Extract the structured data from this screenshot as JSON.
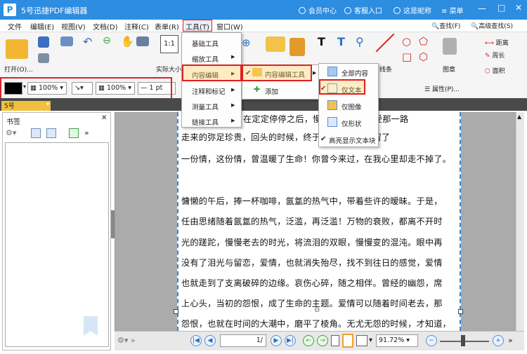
{
  "window": {
    "title": "5号迅捷PDF编辑器",
    "member_center": "会员中心",
    "customer_service": "客服入口",
    "nickname": "这是昵称",
    "menu_label": "菜单"
  },
  "menubar": {
    "items": [
      "文件",
      "编辑(E)",
      "视图(V)",
      "文档(D)",
      "注释(C)",
      "表单(R)",
      "工具(T)",
      "窗口(W)"
    ]
  },
  "ribbon": {
    "open_label": "打开(O)...",
    "actual_size_label": "实际大小",
    "line_label": "线条",
    "stamp_label": "图章",
    "find_label": "查找(F)",
    "advanced_find_label": "高级查找(S)",
    "distance_label": "距离",
    "perimeter_label": "周长",
    "area_label": "面积",
    "add_label": "添加",
    "properties_label": "属性(P)..."
  },
  "format_bar": {
    "opacity_1": "100%",
    "opacity_2": "100%",
    "line_width": "1 pt"
  },
  "tools_menu": {
    "items": [
      "基础工具",
      "缩放工具",
      "内容编辑",
      "注释和标记",
      "测量工具",
      "链接工具"
    ]
  },
  "content_edit_menu": {
    "items": [
      "内容编辑工具",
      "添加"
    ]
  },
  "content_edit_tools_menu": {
    "items": [
      "全部内容",
      "仅文本",
      "仅图像",
      "仅形状",
      "高亮显示文本块"
    ]
  },
  "tab": {
    "label": "5号"
  },
  "sidebar": {
    "title": "书签"
  },
  "document": {
    "lines": [
      "在定定停停之后，慢慢的移步，感受那一路",
      "走来的弥足珍贵，回头的时候，终于的拐角处，逗留了",
      "一份情，这份情，曾温暖了生命！你曾今来过，在我心里却走不掉了。",
      "",
      "慵懒的午后，捧一杯咖啡，氤氲的热气中，带着些许的暧昧。于是，",
      "任由思绪随着氤氲的热气，泛滥，再泛滥！万物的衰败，都离不开时",
      "光的蹉跎，慢慢老去的时光，将流泪的双眼，慢慢变的混沌。眼中再",
      "没有了泪光与留恋，爱情，也就消失殆尽，找不到往日的感觉，爱情",
      "也就走到了支离破碎的边缘。哀伤心碎，随之相伴。曾经的幽怨，席",
      "上心头，当初的怨恨，成了生命的主题。爱情可以随着时间老去，那",
      "怨恨，也就在时间的大潮中，磨平了棱角。无尤无怨的时候，才知道，"
    ]
  },
  "statusbar": {
    "page_value": "1/",
    "zoom_value": "91.72%"
  },
  "colors": {
    "titlebar": "#2d8de0",
    "highlight_red": "#e02020",
    "tab_yellow": "#f0c040",
    "selection_blue": "#2e88d8"
  }
}
